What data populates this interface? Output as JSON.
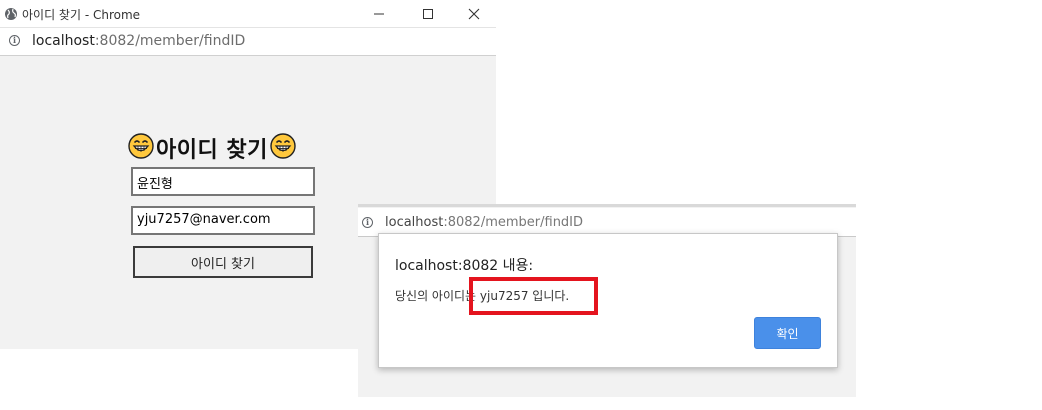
{
  "left_window": {
    "title": "아이디 찾기 - Chrome",
    "icons": {
      "site": "globe-icon",
      "minimize": "minimize-icon",
      "maximize": "maximize-icon",
      "close": "close-icon"
    },
    "address": {
      "host": "localhost",
      "rest": ":8082/member/findID",
      "info_icon": "info-icon"
    },
    "page": {
      "heading_emoji": "😁",
      "heading": "아이디 찾기",
      "name_value": "윤진형",
      "email_value": "yju7257@naver.com",
      "find_button": "아이디 찾기"
    }
  },
  "right_window": {
    "address": {
      "host": "localhost",
      "rest": ":8082/member/findID",
      "info_icon": "info-icon"
    },
    "dialog": {
      "title": "localhost:8082 내용:",
      "message": "당신의 아이디는 yju7257 입니다.",
      "ok_button": "확인"
    }
  },
  "colors": {
    "accent_button": "#4a90ea",
    "highlight_box": "#e4141e",
    "window_bg": "#f2f2f2"
  }
}
